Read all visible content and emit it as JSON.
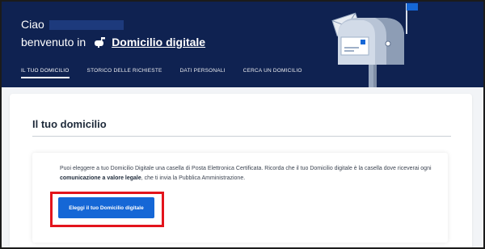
{
  "header": {
    "greeting": "Ciao",
    "welcome_prefix": "benvenuto in",
    "brand_name": "Domicilio digitale",
    "brand_icon": "mailbox-icon"
  },
  "nav": {
    "tabs": [
      {
        "label": "IL TUO DOMICILIO",
        "active": true
      },
      {
        "label": "STORICO DELLE RICHIESTE",
        "active": false
      },
      {
        "label": "DATI PERSONALI",
        "active": false
      },
      {
        "label": "CERCA UN DOMICILIO",
        "active": false
      }
    ]
  },
  "card": {
    "title": "Il tuo domicilio",
    "description_part1": "Puoi eleggere a tuo Domicilio Digitale una casella di Posta Elettronica Certificata. Ricorda che il tuo Domicilio digitale è la casella dove riceverai ogni ",
    "description_bold": "comunicazione a valore legale",
    "description_part2": ", che ti invia la Pubblica Amministrazione.",
    "cta_label": "Eleggi il tuo Domicilio digitale"
  },
  "colors": {
    "header_bg": "#0f2251",
    "primary": "#1567d6",
    "highlight": "#e3141c"
  }
}
